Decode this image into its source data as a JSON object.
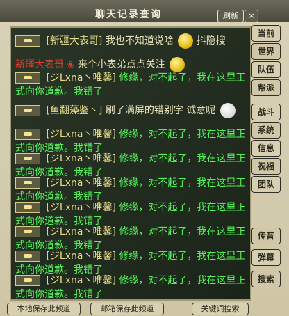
{
  "window": {
    "title": "聊天记录查询",
    "refresh_label": "刷新",
    "close_label": "×"
  },
  "side_tabs": [
    {
      "label": "当前"
    },
    {
      "label": "世界"
    },
    {
      "label": "队伍"
    },
    {
      "label": "帮派"
    },
    {
      "label": "战斗"
    },
    {
      "label": "系统"
    },
    {
      "label": "信息"
    },
    {
      "label": "祝福"
    },
    {
      "label": "团队"
    },
    {
      "label": "传音"
    },
    {
      "label": "弹幕"
    },
    {
      "label": "搜索"
    }
  ],
  "bottom_buttons": [
    {
      "label": "本地保存此频道"
    },
    {
      "label": "邮箱保存此频道"
    },
    {
      "label": "关键词搜索"
    }
  ],
  "messages": [
    {
      "prefix": "[新疆大表哥]",
      "text": "我也不知道说啥",
      "extra": "抖隐搜"
    },
    {
      "prefix": "新疆大表哥",
      "text": "来个小表弟点点关注"
    },
    {
      "prefix": "[ジLxna丶唯馨]",
      "text": "修缘，对不起了，我在这里正式向你道歉。我错了"
    },
    {
      "prefix": "[鱼翻藻鉴丶]",
      "text": "刷了满屏的错别字 诚意呢"
    },
    {
      "prefix": "[ジLxna丶唯馨]",
      "text": "修缘，对不起了，我在这里正式向你道歉。我错了"
    },
    {
      "prefix": "[ジLxna丶唯馨]",
      "text": "修缘，对不起了，我在这里正式向你道歉。我错了"
    },
    {
      "prefix": "[ジLxna丶唯馨]",
      "text": "修缘，对不起了，我在这里正式向你道歉。我错了"
    },
    {
      "prefix": "[ジLxna丶唯馨]",
      "text": "修缘，对不起了，我在这里正式向你道歉。我错了"
    },
    {
      "prefix": "[ジLxna丶唯馨]",
      "text": "修缘，对不起了，我在这里正式向你道歉。我错了"
    },
    {
      "prefix": "[ジLxna丶唯馨]",
      "text": "修缘，对不起了，我在这里正式向你道歉。我错了"
    },
    {
      "prefix": "[ジLxna丶唯馨]",
      "text": "修缘，对不起了，我在这里正式向你道歉。我错了"
    }
  ]
}
